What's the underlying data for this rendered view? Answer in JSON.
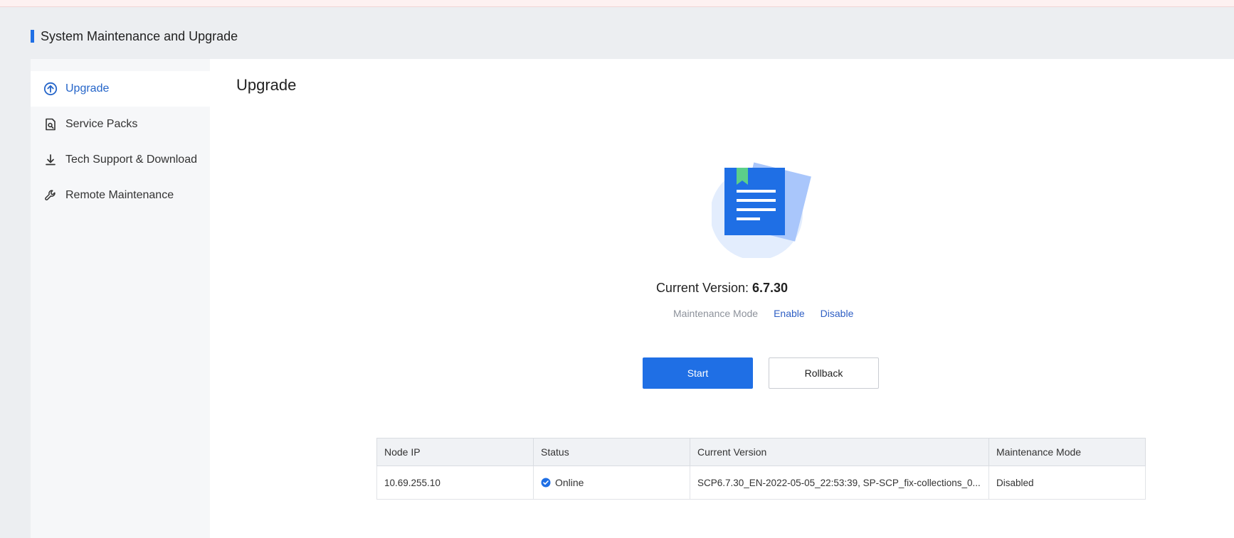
{
  "header": {
    "title": "System Maintenance and Upgrade"
  },
  "sidebar": {
    "items": [
      {
        "label": "Upgrade",
        "icon": "upgrade-circle-arrow-icon",
        "active": true
      },
      {
        "label": "Service Packs",
        "icon": "service-pack-icon",
        "active": false
      },
      {
        "label": "Tech Support & Download",
        "icon": "download-icon",
        "active": false
      },
      {
        "label": "Remote Maintenance",
        "icon": "wrench-icon",
        "active": false
      }
    ]
  },
  "main": {
    "title": "Upgrade",
    "illustration": "document-bookmark-icon",
    "version_label": "Current Version:",
    "version_value": "6.7.30",
    "maintenance_label": "Maintenance Mode",
    "enable_link": "Enable",
    "disable_link": "Disable",
    "start_button": "Start",
    "rollback_button": "Rollback"
  },
  "table": {
    "columns": [
      "Node IP",
      "Status",
      "Current Version",
      "Maintenance Mode"
    ],
    "rows": [
      {
        "node_ip": "10.69.255.10",
        "status": "Online",
        "current_version": "SCP6.7.30_EN-2022-05-05_22:53:39, SP-SCP_fix-collections_0...",
        "maintenance_mode": "Disabled"
      }
    ]
  },
  "colors": {
    "accent": "#1f6fe5",
    "link": "#2f5fc4",
    "status_online": "#1f6fe5",
    "bookmark": "#5ccf8a"
  }
}
